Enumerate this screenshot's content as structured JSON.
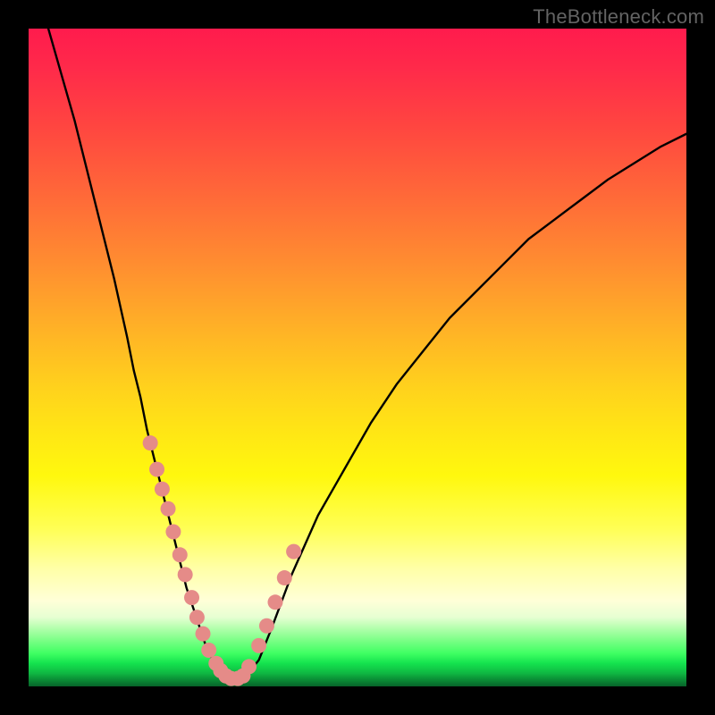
{
  "watermark": "TheBottleneck.com",
  "colors": {
    "curve_stroke": "#000000",
    "marker_fill": "#e58b88",
    "marker_stroke": "#bf6462"
  },
  "chart_data": {
    "type": "line",
    "title": "",
    "xlabel": "",
    "ylabel": "",
    "xlim": [
      0,
      100
    ],
    "ylim": [
      0,
      100
    ],
    "x": [
      3,
      5,
      7,
      9,
      11,
      13,
      15,
      16,
      17,
      18,
      19,
      20,
      21,
      22,
      23,
      24,
      25,
      26,
      27,
      28,
      29,
      30,
      31,
      32,
      33,
      35,
      37,
      40,
      44,
      48,
      52,
      56,
      60,
      64,
      68,
      72,
      76,
      80,
      84,
      88,
      92,
      96,
      100
    ],
    "y": [
      100,
      93,
      86,
      78,
      70,
      62,
      53,
      48,
      44,
      39,
      35,
      31,
      27,
      23,
      19,
      15,
      12,
      9,
      6,
      4,
      2.5,
      1.5,
      1,
      1,
      1.5,
      4,
      9,
      17,
      26,
      33,
      40,
      46,
      51,
      56,
      60,
      64,
      68,
      71,
      74,
      77,
      79.5,
      82,
      84
    ],
    "markers": {
      "x": [
        18.5,
        19.5,
        20.3,
        21.2,
        22.0,
        23.0,
        23.8,
        24.8,
        25.6,
        26.5,
        27.4,
        28.5,
        29.2,
        30.0,
        30.8,
        31.8,
        32.6,
        33.5,
        35.0,
        36.2,
        37.5,
        38.9,
        40.3
      ],
      "y": [
        37,
        33,
        30,
        27,
        23.5,
        20,
        17,
        13.5,
        10.5,
        8,
        5.5,
        3.5,
        2.4,
        1.6,
        1.2,
        1.2,
        1.6,
        3.0,
        6.2,
        9.2,
        12.8,
        16.5,
        20.5
      ]
    }
  }
}
